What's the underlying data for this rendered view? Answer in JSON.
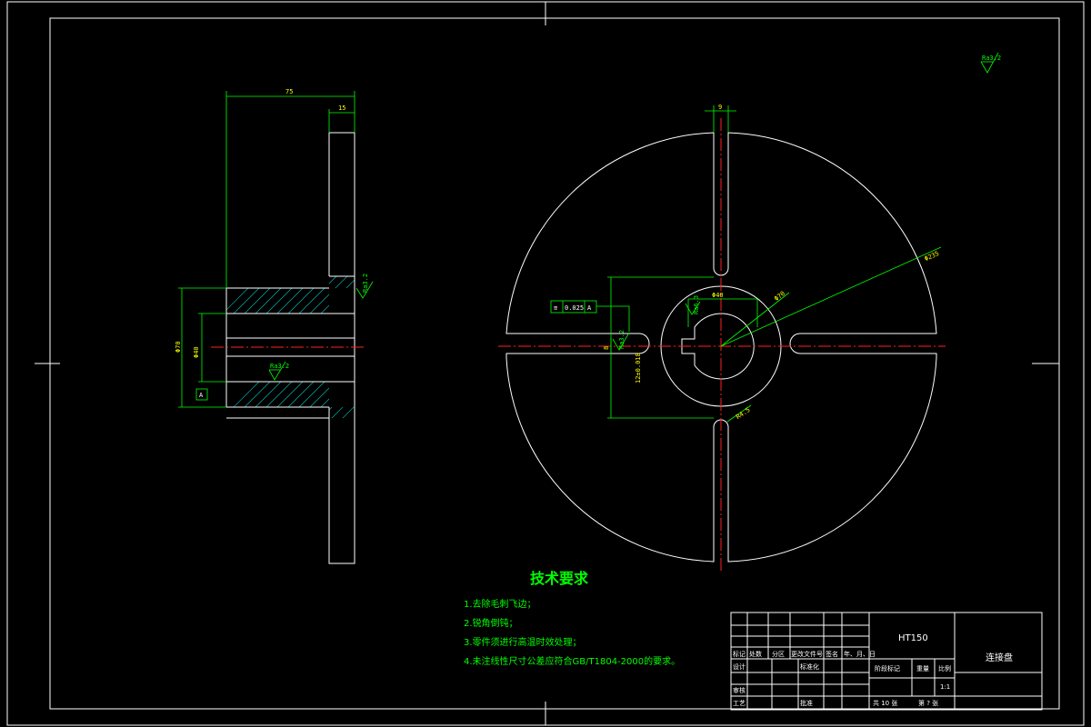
{
  "drawing": {
    "roughness_general": "Ra3.2",
    "side_view": {
      "dim_length": "75",
      "dim_flange": "15",
      "dim_outer_dia": "Φ70",
      "dim_bore_dia": "Φ40",
      "dim_bore_tol": "+0.025\n0",
      "roughness_top": "Ra3.2",
      "roughness_bore": "Ra3.2",
      "datum": "A"
    },
    "front_view": {
      "dim_slot_width": "9",
      "dim_keyway_width": "12±0.018",
      "dim_keyway_depth": "43.3",
      "dim_bore": "Φ40",
      "dim_hub": "Φ70",
      "dim_outer": "Φ235",
      "dim_slot_r": "R4.5",
      "dim_key": "8",
      "roughness_keyway": "Ra3.2",
      "roughness_side": "Ra6.3",
      "tolerance_symbol": "≡",
      "tolerance_value": "0.025",
      "tolerance_datum": "A"
    }
  },
  "tech_requirements": {
    "title": "技术要求",
    "items": [
      "1.去除毛刺飞边；",
      "2.锐角倒钝；",
      "3.零件须进行高温时效处理；",
      "4.未注线性尺寸公差应符合GB/T1804-2000的要求。"
    ]
  },
  "title_block": {
    "material": "HT150",
    "part_name": "连接盘",
    "headers": [
      "标记",
      "处数",
      "分区",
      "更改文件号",
      "签名",
      "年、月、日"
    ],
    "design": "设计",
    "standard": "标准化",
    "review": "审核",
    "process": "工艺",
    "approve": "批准",
    "stage_mark": "阶段标记",
    "weight": "重量",
    "scale_label": "比例",
    "scale_value": "1:1",
    "sheets_total": "共  10  张",
    "sheet_no": "第  ?  张"
  }
}
